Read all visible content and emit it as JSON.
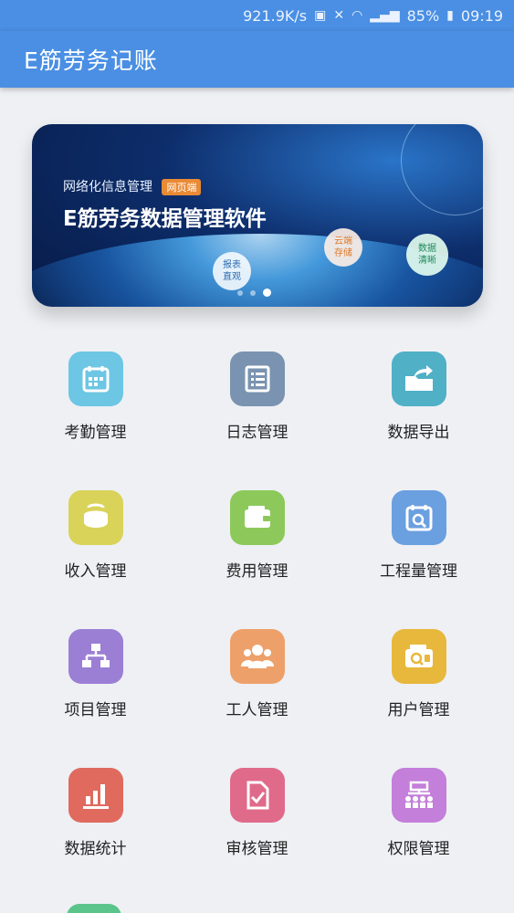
{
  "status_bar": {
    "speed": "921.9K/s",
    "battery": "85%",
    "time": "09:19"
  },
  "app_bar": {
    "title": "E筋劳务记账"
  },
  "banner": {
    "subtitle": "网络化信息管理",
    "tag": "网页端",
    "headline": "E筋劳务数据管理软件",
    "bubbles": [
      "报表\n直观",
      "云端\n存储",
      "数据\n清晰"
    ],
    "page_count": 3,
    "active_page": 3
  },
  "menu": [
    {
      "label": "考勤管理",
      "icon": "calendar-icon",
      "color": "#6cc6e4"
    },
    {
      "label": "日志管理",
      "icon": "log-list-icon",
      "color": "#7a93b0"
    },
    {
      "label": "数据导出",
      "icon": "folder-export-icon",
      "color": "#4fb0c6"
    },
    {
      "label": "收入管理",
      "icon": "purse-icon",
      "color": "#d9d35a"
    },
    {
      "label": "费用管理",
      "icon": "wallet-icon",
      "color": "#8cc95a"
    },
    {
      "label": "工程量管理",
      "icon": "calendar-search-icon",
      "color": "#6a9fe0"
    },
    {
      "label": "项目管理",
      "icon": "org-chart-icon",
      "color": "#9b7fd4"
    },
    {
      "label": "工人管理",
      "icon": "workers-icon",
      "color": "#eea06a"
    },
    {
      "label": "用户管理",
      "icon": "user-card-icon",
      "color": "#e8b83c"
    },
    {
      "label": "数据统计",
      "icon": "bar-stats-icon",
      "color": "#e06a5e"
    },
    {
      "label": "审核管理",
      "icon": "document-check-icon",
      "color": "#e06a8a"
    },
    {
      "label": "权限管理",
      "icon": "hierarchy-icon",
      "color": "#c37fd9"
    }
  ]
}
